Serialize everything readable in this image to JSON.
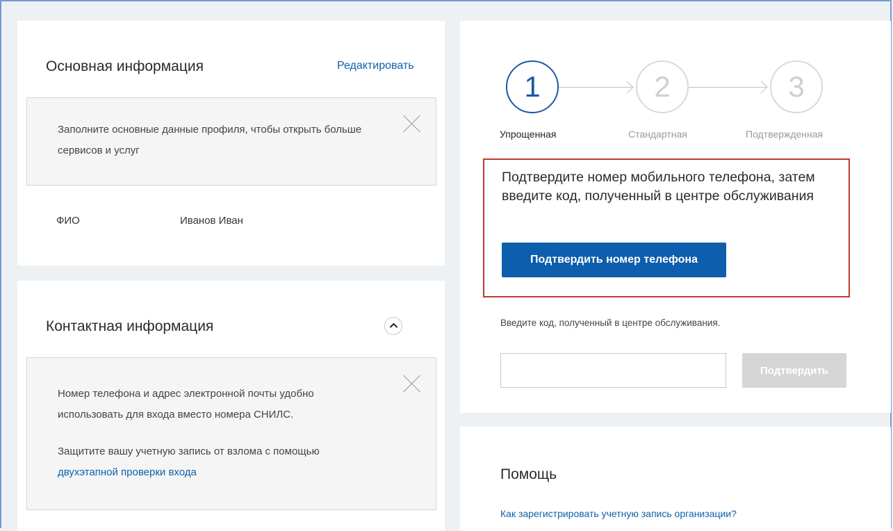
{
  "basic": {
    "title": "Основная информация",
    "edit_label": "Редактировать",
    "notice_text": "Заполните основные данные профиля, чтобы открыть больше сервисов и услуг",
    "fio_label": "ФИО",
    "fio_value": "Иванов Иван"
  },
  "contact": {
    "title": "Контактная информация",
    "notice_line1": "Номер телефона и адрес электронной почты удобно использовать для входа вместо номера СНИЛС.",
    "notice_line2": "Защитите вашу учетную запись от взлома с помощью",
    "notice_link": "двухэтапной проверки входа"
  },
  "status": {
    "steps": [
      {
        "number": "1",
        "label": "Упрощенная",
        "active": true
      },
      {
        "number": "2",
        "label": "Стандартная",
        "active": false
      },
      {
        "number": "3",
        "label": "Подтвержденная",
        "active": false
      }
    ],
    "confirm_text": "Подтвердите номер мобильного телефона, затем введите код, полученный в центре обслуживания",
    "confirm_phone_button": "Подтвердить номер телефона",
    "code_hint": "Введите код, полученный в центре обслуживания.",
    "code_input_value": "",
    "confirm_button": "Подтвердить"
  },
  "help": {
    "title": "Помощь",
    "link": "Как зарегистрировать учетную запись организации?"
  },
  "colors": {
    "accent": "#0d5ead",
    "link": "#0b61aa",
    "highlight_border": "#c0392b",
    "disabled": "#d6d6d6"
  }
}
